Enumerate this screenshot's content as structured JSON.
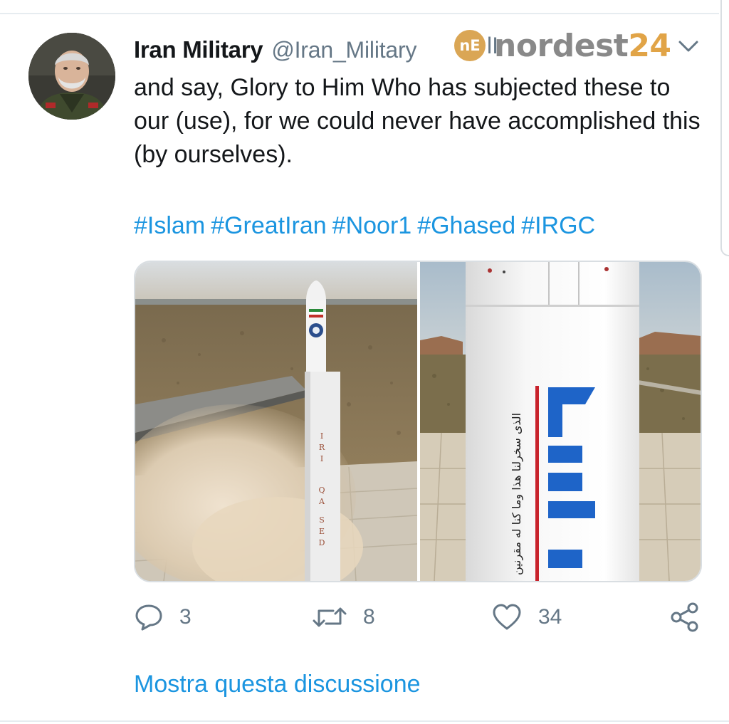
{
  "tweet": {
    "display_name": "Iran Military",
    "handle": "@Iran_Military",
    "handle_tail": "lI",
    "text": "and say, Glory to Him Who has subjected these to our (use), for we could never have accomplished this (by ourselves).",
    "hashtags": [
      "#Islam",
      "#GreatIran",
      "#Noor1",
      "#Ghased",
      "#IRGC"
    ]
  },
  "watermark": {
    "logo_text": "nE",
    "text_part1": "nordest",
    "text_part2": "24"
  },
  "media": {
    "left_image_subject": "rocket-launch-photo",
    "right_image_subject": "rocket-closeup-photo",
    "rocket_letters": [
      "I",
      "R",
      "I",
      "Q",
      "A",
      "S",
      "E",
      "D"
    ],
    "rocket_script": "الذى سخرلنا هذا وما كنا له مقرنين"
  },
  "actions": {
    "reply_count": "3",
    "retweet_count": "8",
    "like_count": "34"
  },
  "show_thread": "Mostra questa discussione",
  "icons": {
    "reply": "speech-bubble-icon",
    "retweet": "retweet-arrows-icon",
    "like": "heart-icon",
    "share": "share-icon",
    "menu": "chevron-down-icon"
  },
  "colors": {
    "link": "#1b95e0",
    "secondary_text": "#657786",
    "primary_text": "#14171a",
    "watermark_orange": "#e1a447",
    "watermark_gray": "#7d7d7d"
  }
}
